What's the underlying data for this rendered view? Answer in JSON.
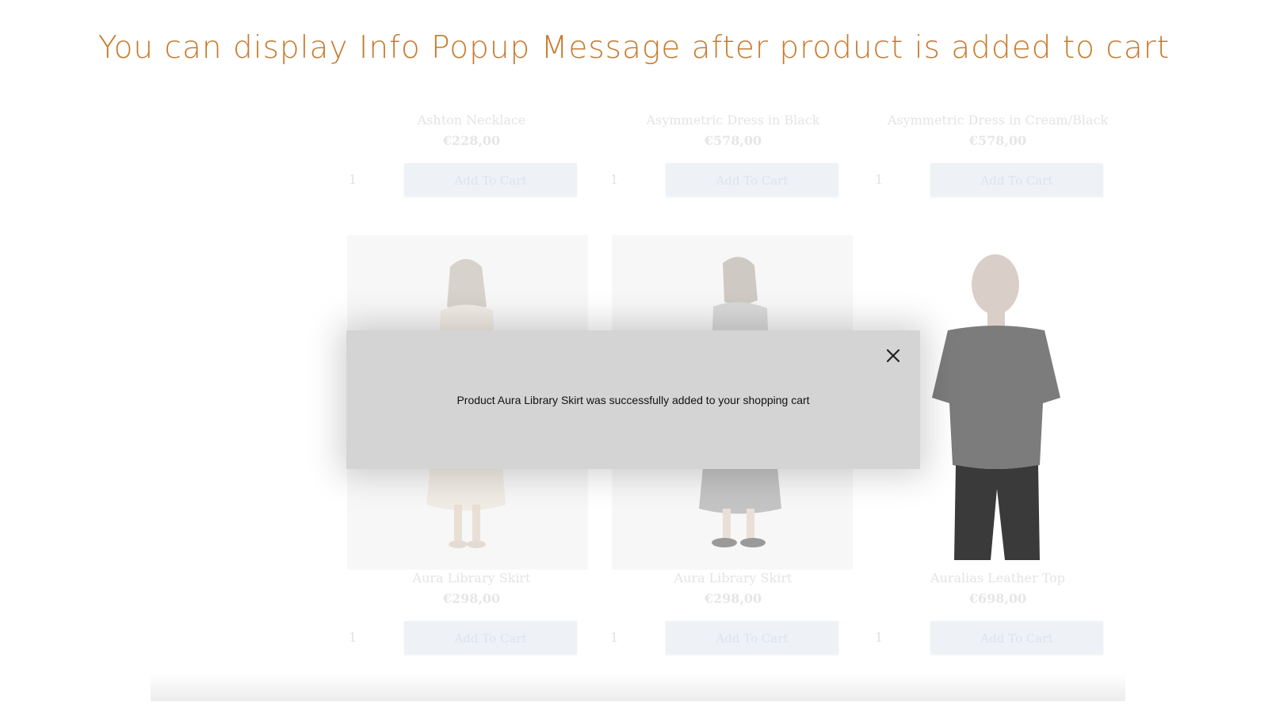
{
  "headline": "You can display Info Popup Message after product is added to cart",
  "colors": {
    "headline": "#c97a2e",
    "popup_bg": "#d4d4d4",
    "button_bg": "#eef2f6"
  },
  "products_top": [
    {
      "name": "Ashton Necklace",
      "price": "€228,00",
      "qty": "1",
      "button": "Add To Cart"
    },
    {
      "name": "Asymmetric Dress in Black",
      "price": "€578,00",
      "qty": "1",
      "button": "Add To Cart"
    },
    {
      "name": "Asymmetric Dress in Cream/Black",
      "price": "€578,00",
      "qty": "1",
      "button": "Add To Cart"
    }
  ],
  "products_bottom": [
    {
      "name": "Aura Library Skirt",
      "price": "€298,00",
      "qty": "1",
      "button": "Add To Cart"
    },
    {
      "name": "Aura Library Skirt",
      "price": "€298,00",
      "qty": "1",
      "button": "Add To Cart"
    },
    {
      "name": "Auralias Leather Top",
      "price": "€698,00",
      "qty": "1",
      "button": "Add To Cart"
    }
  ],
  "popup": {
    "message": "Product Aura Library Skirt was successfully added to your shopping cart",
    "close_icon": "close-icon"
  }
}
